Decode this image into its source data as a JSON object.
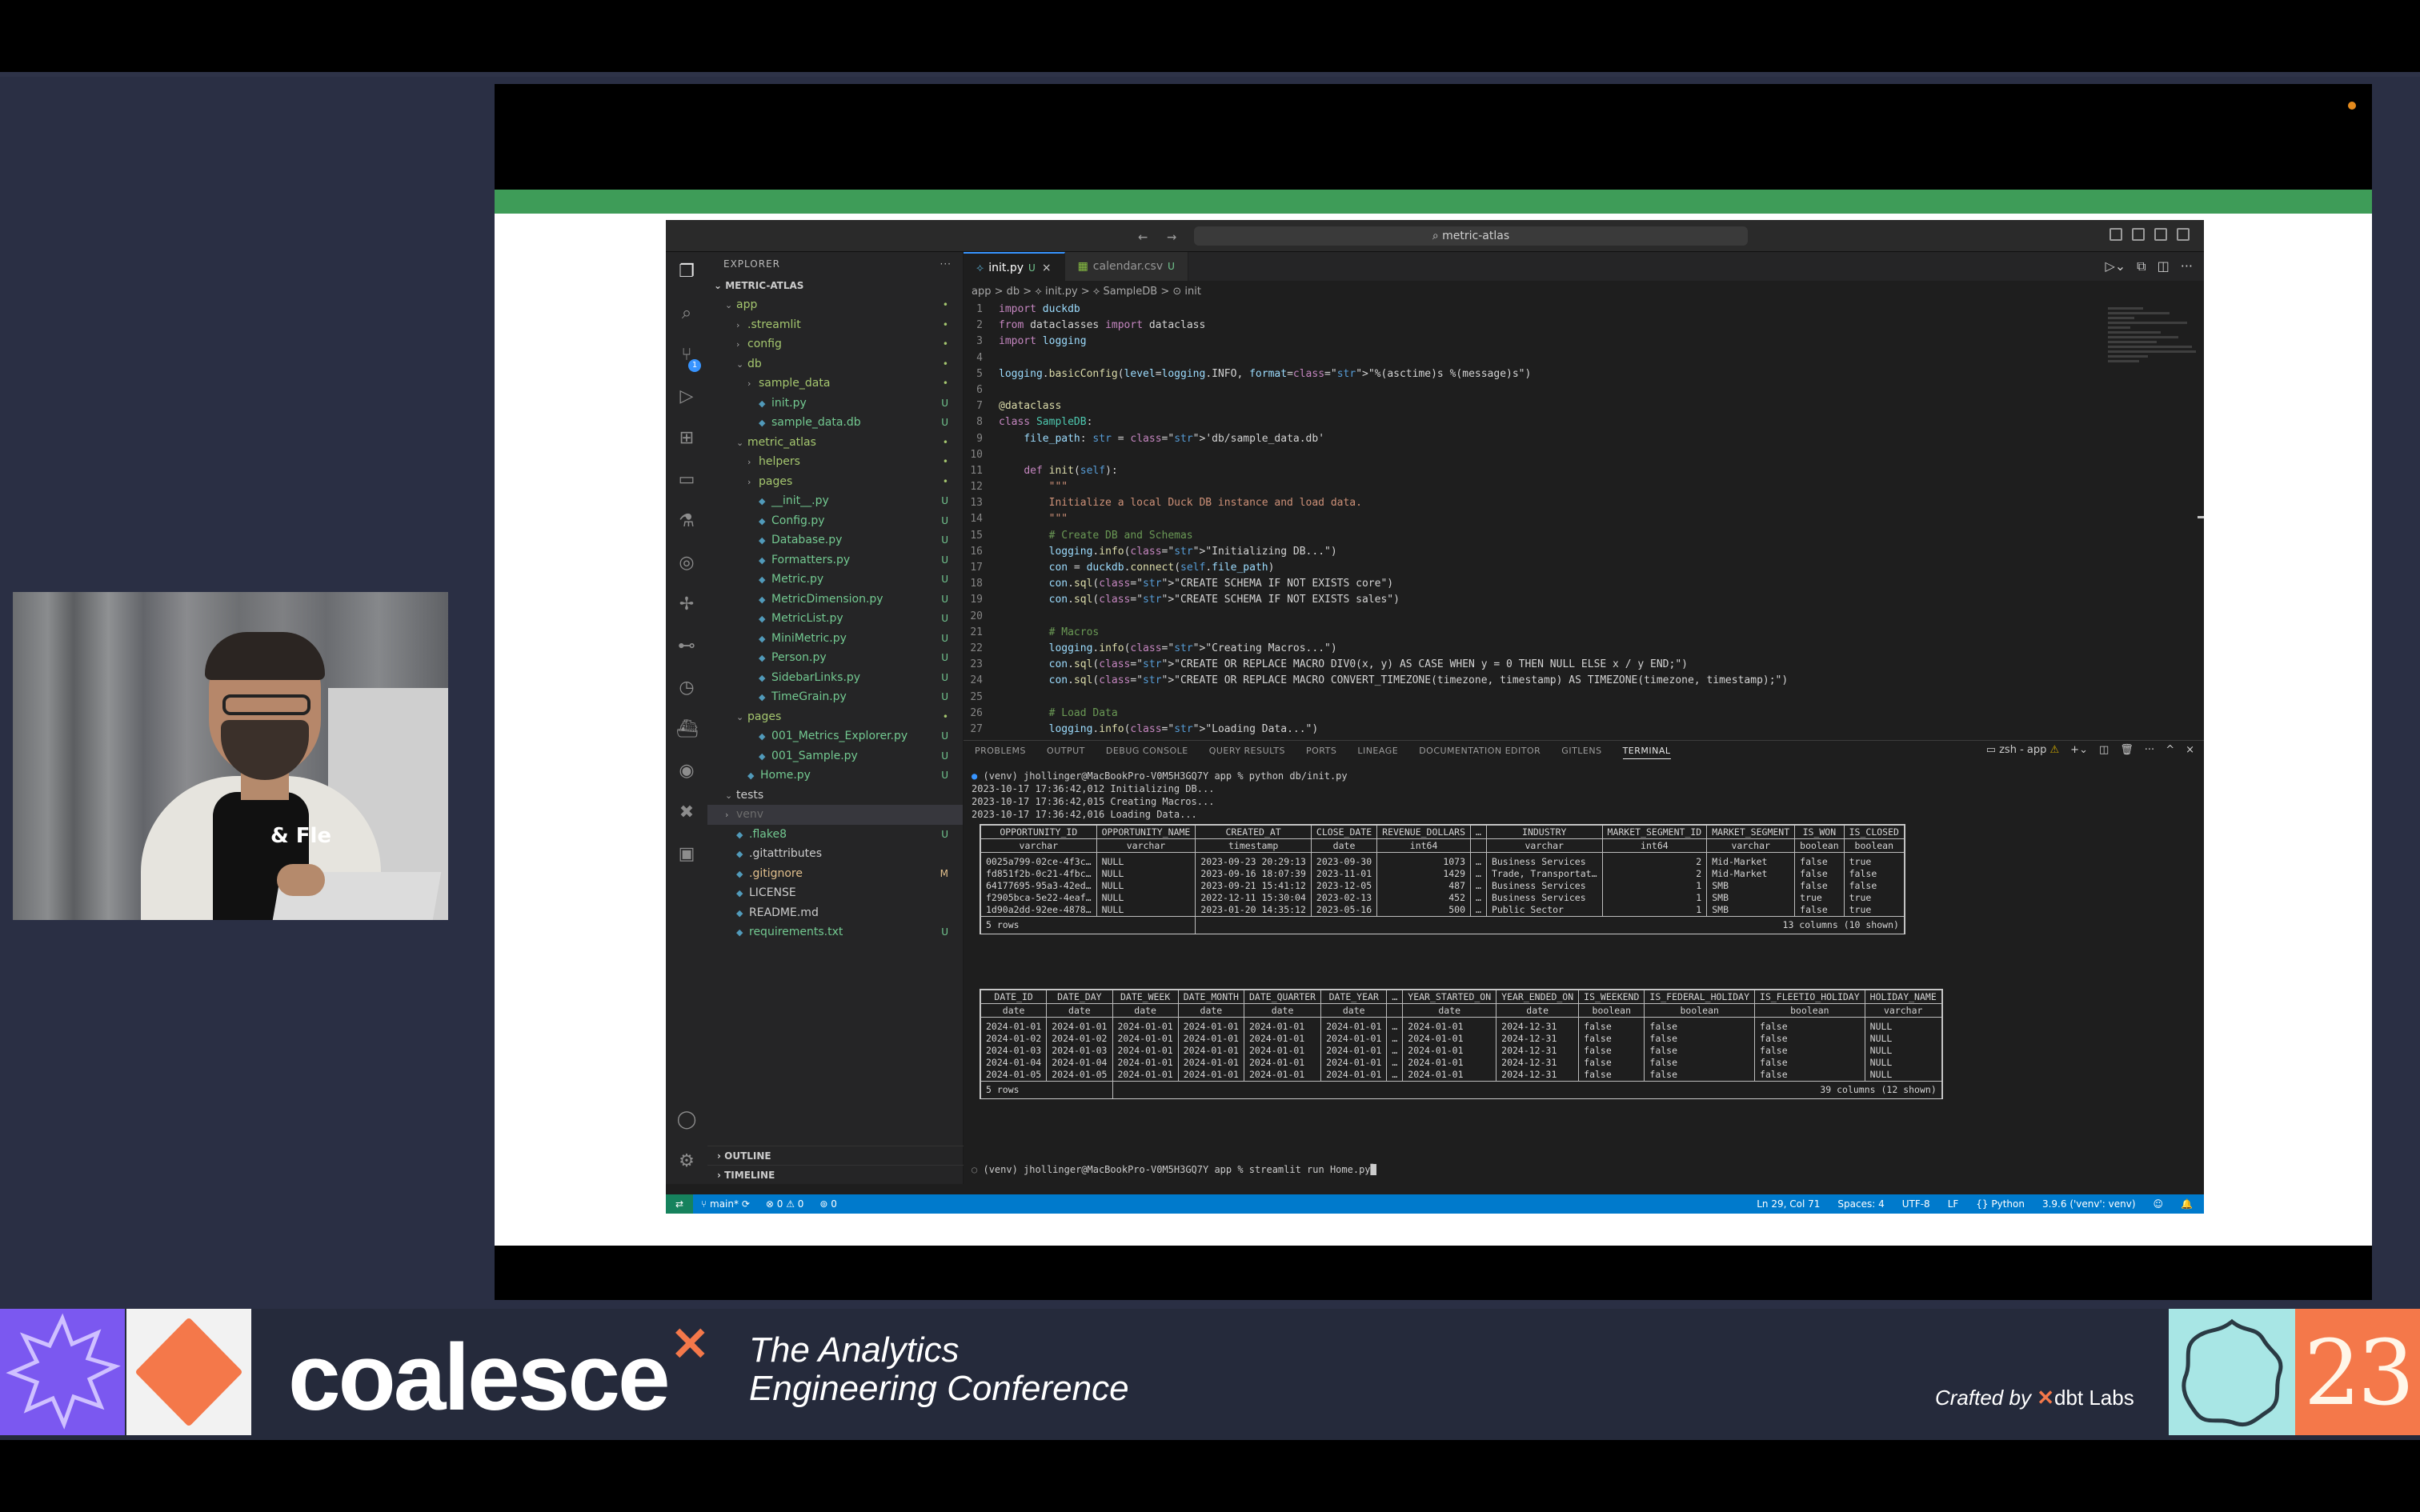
{
  "window": {
    "command_center": "metric-atlas"
  },
  "explorer": {
    "header": "EXPLORER",
    "more": "···",
    "root": "METRIC-ATLAS",
    "items": [
      {
        "label": "app",
        "depth": 1,
        "kind": "folder-open",
        "status": "•"
      },
      {
        "label": ".streamlit",
        "depth": 2,
        "kind": "folder",
        "status": "•"
      },
      {
        "label": "config",
        "depth": 2,
        "kind": "folder",
        "status": "•"
      },
      {
        "label": "db",
        "depth": 2,
        "kind": "folder-open",
        "status": "•"
      },
      {
        "label": "sample_data",
        "depth": 3,
        "kind": "folder",
        "status": "•"
      },
      {
        "label": "init.py",
        "depth": 3,
        "kind": "file",
        "status": "U"
      },
      {
        "label": "sample_data.db",
        "depth": 3,
        "kind": "file",
        "status": "U"
      },
      {
        "label": "metric_atlas",
        "depth": 2,
        "kind": "folder-open",
        "status": "•"
      },
      {
        "label": "helpers",
        "depth": 3,
        "kind": "folder",
        "status": "•"
      },
      {
        "label": "pages",
        "depth": 3,
        "kind": "folder",
        "status": "•"
      },
      {
        "label": "__init__.py",
        "depth": 3,
        "kind": "file",
        "status": "U"
      },
      {
        "label": "Config.py",
        "depth": 3,
        "kind": "file",
        "status": "U"
      },
      {
        "label": "Database.py",
        "depth": 3,
        "kind": "file",
        "status": "U"
      },
      {
        "label": "Formatters.py",
        "depth": 3,
        "kind": "file",
        "status": "U"
      },
      {
        "label": "Metric.py",
        "depth": 3,
        "kind": "file",
        "status": "U"
      },
      {
        "label": "MetricDimension.py",
        "depth": 3,
        "kind": "file",
        "status": "U"
      },
      {
        "label": "MetricList.py",
        "depth": 3,
        "kind": "file",
        "status": "U"
      },
      {
        "label": "MiniMetric.py",
        "depth": 3,
        "kind": "file",
        "status": "U"
      },
      {
        "label": "Person.py",
        "depth": 3,
        "kind": "file",
        "status": "U"
      },
      {
        "label": "SidebarLinks.py",
        "depth": 3,
        "kind": "file",
        "status": "U"
      },
      {
        "label": "TimeGrain.py",
        "depth": 3,
        "kind": "file",
        "status": "U"
      },
      {
        "label": "pages",
        "depth": 2,
        "kind": "folder-open",
        "status": "•"
      },
      {
        "label": "001_Metrics_Explorer.py",
        "depth": 3,
        "kind": "file",
        "status": "U"
      },
      {
        "label": "001_Sample.py",
        "depth": 3,
        "kind": "file",
        "status": "U"
      },
      {
        "label": "Home.py",
        "depth": 2,
        "kind": "file",
        "status": "U"
      },
      {
        "label": "tests",
        "depth": 1,
        "kind": "folder-open",
        "status": ""
      },
      {
        "label": "venv",
        "depth": 1,
        "kind": "folder-dim",
        "status": ""
      },
      {
        "label": ".flake8",
        "depth": 1,
        "kind": "file",
        "status": "U"
      },
      {
        "label": ".gitattributes",
        "depth": 1,
        "kind": "file",
        "status": ""
      },
      {
        "label": ".gitignore",
        "depth": 1,
        "kind": "file",
        "status": "M"
      },
      {
        "label": "LICENSE",
        "depth": 1,
        "kind": "file",
        "status": ""
      },
      {
        "label": "README.md",
        "depth": 1,
        "kind": "file",
        "status": ""
      },
      {
        "label": "requirements.txt",
        "depth": 1,
        "kind": "file",
        "status": "U"
      }
    ],
    "outline": "OUTLINE",
    "timeline": "TIMELINE"
  },
  "tabs": [
    {
      "label": "init.py",
      "modified": "U",
      "close": "×",
      "active": true
    },
    {
      "label": "calendar.csv",
      "modified": "U",
      "close": "",
      "active": false
    }
  ],
  "breadcrumb": "app > db > ⟡ init.py > ⟡ SampleDB > ⊙ init",
  "code_lines": [
    {
      "n": "1",
      "text": "import duckdb"
    },
    {
      "n": "2",
      "text": "from dataclasses import dataclass"
    },
    {
      "n": "3",
      "text": "import logging"
    },
    {
      "n": "4",
      "text": ""
    },
    {
      "n": "5",
      "text": "logging.basicConfig(level=logging.INFO, format=\"%(asctime)s %(message)s\")"
    },
    {
      "n": "6",
      "text": ""
    },
    {
      "n": "7",
      "text": "@dataclass"
    },
    {
      "n": "8",
      "text": "class SampleDB:"
    },
    {
      "n": "9",
      "text": "    file_path: str = 'db/sample_data.db'"
    },
    {
      "n": "10",
      "text": ""
    },
    {
      "n": "11",
      "text": "    def init(self):"
    },
    {
      "n": "12",
      "text": "        \"\"\""
    },
    {
      "n": "13",
      "text": "        Initialize a local Duck DB instance and load data."
    },
    {
      "n": "14",
      "text": "        \"\"\""
    },
    {
      "n": "15",
      "text": "        # Create DB and Schemas"
    },
    {
      "n": "16",
      "text": "        logging.info(\"Initializing DB...\")"
    },
    {
      "n": "17",
      "text": "        con = duckdb.connect(self.file_path)"
    },
    {
      "n": "18",
      "text": "        con.sql(\"CREATE SCHEMA IF NOT EXISTS core\")"
    },
    {
      "n": "19",
      "text": "        con.sql(\"CREATE SCHEMA IF NOT EXISTS sales\")"
    },
    {
      "n": "20",
      "text": ""
    },
    {
      "n": "21",
      "text": "        # Macros"
    },
    {
      "n": "22",
      "text": "        logging.info(\"Creating Macros...\")"
    },
    {
      "n": "23",
      "text": "        con.sql(\"CREATE OR REPLACE MACRO DIV0(x, y) AS CASE WHEN y = 0 THEN NULL ELSE x / y END;\")"
    },
    {
      "n": "24",
      "text": "        con.sql(\"CREATE OR REPLACE MACRO CONVERT_TIMEZONE(timezone, timestamp) AS TIMEZONE(timezone, timestamp);\")"
    },
    {
      "n": "25",
      "text": ""
    },
    {
      "n": "26",
      "text": "        # Load Data"
    },
    {
      "n": "27",
      "text": "        logging.info(\"Loading Data...\")"
    }
  ],
  "panel_tabs": [
    "PROBLEMS",
    "OUTPUT",
    "DEBUG CONSOLE",
    "QUERY RESULTS",
    "PORTS",
    "LINEAGE",
    "DOCUMENTATION EDITOR",
    "GITLENS",
    "TERMINAL"
  ],
  "panel_shell": "zsh - app",
  "terminal_lines": [
    "(venv) jhollinger@MacBookPro-V0M5H3GQ7Y app % python db/init.py",
    "2023-10-17 17:36:42,012 Initializing DB...",
    "2023-10-17 17:36:42,015 Creating Macros...",
    "2023-10-17 17:36:42,016 Loading Data..."
  ],
  "table1": {
    "headers": [
      "OPPORTUNITY_ID",
      "OPPORTUNITY_NAME",
      "CREATED_AT",
      "CLOSE_DATE",
      "REVENUE_DOLLARS",
      "…",
      "INDUSTRY",
      "MARKET_SEGMENT_ID",
      "MARKET_SEGMENT",
      "IS_WON",
      "IS_CLOSED"
    ],
    "types": [
      "varchar",
      "varchar",
      "timestamp",
      "date",
      "int64",
      "",
      "varchar",
      "int64",
      "varchar",
      "boolean",
      "boolean"
    ],
    "rows": [
      [
        "0025a799-02ce-4f3c…",
        "NULL",
        "2023-09-23 20:29:13",
        "2023-09-30",
        "1073",
        "…",
        "Business Services",
        "2",
        "Mid-Market",
        "false",
        "true"
      ],
      [
        "fd851f2b-0c21-4fbc…",
        "NULL",
        "2023-09-16 18:07:39",
        "2023-11-01",
        "1429",
        "…",
        "Trade, Transportat…",
        "2",
        "Mid-Market",
        "false",
        "false"
      ],
      [
        "64177695-95a3-42ed…",
        "NULL",
        "2023-09-21 15:41:12",
        "2023-12-05",
        "487",
        "…",
        "Business Services",
        "1",
        "SMB",
        "false",
        "false"
      ],
      [
        "f2905bca-5e22-4eaf…",
        "NULL",
        "2022-12-11 15:30:04",
        "2023-02-13",
        "452",
        "…",
        "Business Services",
        "1",
        "SMB",
        "true",
        "true"
      ],
      [
        "1d90a2dd-92ee-4878…",
        "NULL",
        "2023-01-20 14:35:12",
        "2023-05-16",
        "500",
        "…",
        "Public Sector",
        "1",
        "SMB",
        "false",
        "true"
      ]
    ],
    "footer_left": "5 rows",
    "footer_right": "13 columns (10 shown)"
  },
  "table2": {
    "headers": [
      "DATE_ID",
      "DATE_DAY",
      "DATE_WEEK",
      "DATE_MONTH",
      "DATE_QUARTER",
      "DATE_YEAR",
      "…",
      "YEAR_STARTED_ON",
      "YEAR_ENDED_ON",
      "IS_WEEKEND",
      "IS_FEDERAL_HOLIDAY",
      "IS_FLEETIO_HOLIDAY",
      "HOLIDAY_NAME"
    ],
    "types": [
      "date",
      "date",
      "date",
      "date",
      "date",
      "date",
      "",
      "date",
      "date",
      "boolean",
      "boolean",
      "boolean",
      "varchar"
    ],
    "rows": [
      [
        "2024-01-01",
        "2024-01-01",
        "2024-01-01",
        "2024-01-01",
        "2024-01-01",
        "2024-01-01",
        "…",
        "2024-01-01",
        "2024-12-31",
        "false",
        "false",
        "false",
        "NULL"
      ],
      [
        "2024-01-02",
        "2024-01-02",
        "2024-01-01",
        "2024-01-01",
        "2024-01-01",
        "2024-01-01",
        "…",
        "2024-01-01",
        "2024-12-31",
        "false",
        "false",
        "false",
        "NULL"
      ],
      [
        "2024-01-03",
        "2024-01-03",
        "2024-01-01",
        "2024-01-01",
        "2024-01-01",
        "2024-01-01",
        "…",
        "2024-01-01",
        "2024-12-31",
        "false",
        "false",
        "false",
        "NULL"
      ],
      [
        "2024-01-04",
        "2024-01-04",
        "2024-01-01",
        "2024-01-01",
        "2024-01-01",
        "2024-01-01",
        "…",
        "2024-01-01",
        "2024-12-31",
        "false",
        "false",
        "false",
        "NULL"
      ],
      [
        "2024-01-05",
        "2024-01-05",
        "2024-01-01",
        "2024-01-01",
        "2024-01-01",
        "2024-01-01",
        "…",
        "2024-01-01",
        "2024-12-31",
        "false",
        "false",
        "false",
        "NULL"
      ]
    ],
    "footer_left": "5 rows",
    "footer_right": "39 columns (12 shown)"
  },
  "terminal_prompt": "(venv) jhollinger@MacBookPro-V0M5H3GQ7Y app % streamlit run Home.py",
  "status": {
    "branch": "main*",
    "problems": "⊗ 0 ⚠ 0",
    "ports": "⊚ 0",
    "position": "Ln 29, Col 71",
    "spaces": "Spaces: 4",
    "encoding": "UTF-8",
    "eol": "LF",
    "language": "{} Python",
    "interpreter": "3.9.6 ('venv': venv)"
  },
  "conference": {
    "brand": "coalesce",
    "tagline_1": "The Analytics",
    "tagline_2": "Engineering Conference",
    "crafted_prefix": "Crafted by",
    "crafted_brand": "dbt Labs",
    "year": "23",
    "shirt_text": "& Fle"
  },
  "colors": {
    "accent_blue": "#007acc",
    "conference_orange": "#f4784a",
    "conference_purple": "#7b58f0",
    "conference_teal": "#a8e6e5",
    "slide_green": "#3e9c58"
  }
}
